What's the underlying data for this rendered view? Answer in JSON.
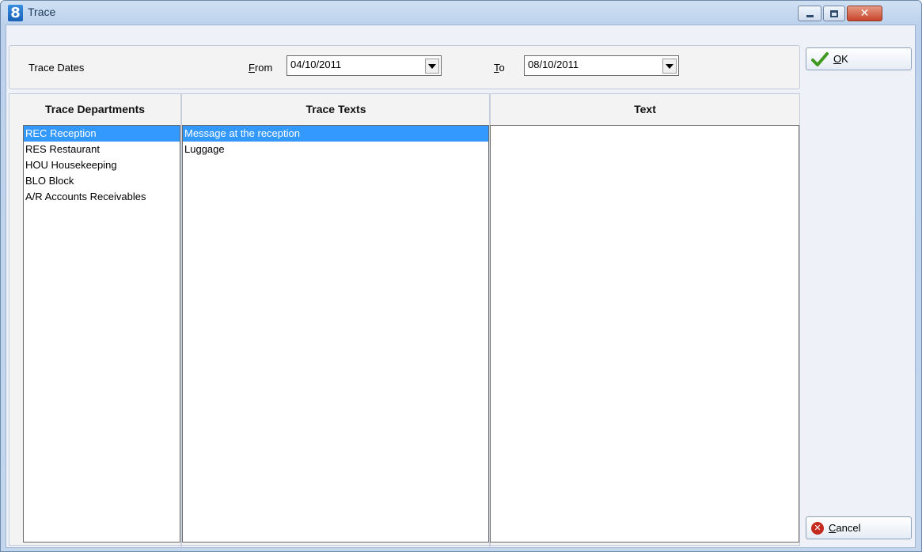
{
  "window": {
    "title": "Trace",
    "app_icon_glyph": "8",
    "close_glyph": "✕"
  },
  "trace_dates": {
    "label": "Trace Dates",
    "from_prefix": "F",
    "from_rest": "rom",
    "from_value": "04/10/2011",
    "to_prefix": "T",
    "to_rest": "o",
    "to_value": "08/10/2011"
  },
  "columns": {
    "departments_header": "Trace Departments",
    "texts_header": "Trace Texts",
    "text_header": "Text"
  },
  "departments": [
    {
      "label": "REC Reception",
      "selected": true
    },
    {
      "label": "RES Restaurant",
      "selected": false
    },
    {
      "label": "HOU Housekeeping",
      "selected": false
    },
    {
      "label": "BLO Block",
      "selected": false
    },
    {
      "label": "A/R Accounts Receivables",
      "selected": false
    }
  ],
  "trace_texts": [
    {
      "label": "Message at the reception",
      "selected": true
    },
    {
      "label": "Luggage",
      "selected": false
    }
  ],
  "buttons": {
    "ok_prefix": "O",
    "ok_rest": "K",
    "cancel_prefix": "C",
    "cancel_rest": "ancel"
  },
  "icons": {
    "ok": "check-icon",
    "cancel": "cancel-icon",
    "dropdown": "chevron-down-icon"
  },
  "colors": {
    "selection": "#3399ff",
    "check": "#3f9a1f",
    "cancel": "#c42b1c"
  }
}
